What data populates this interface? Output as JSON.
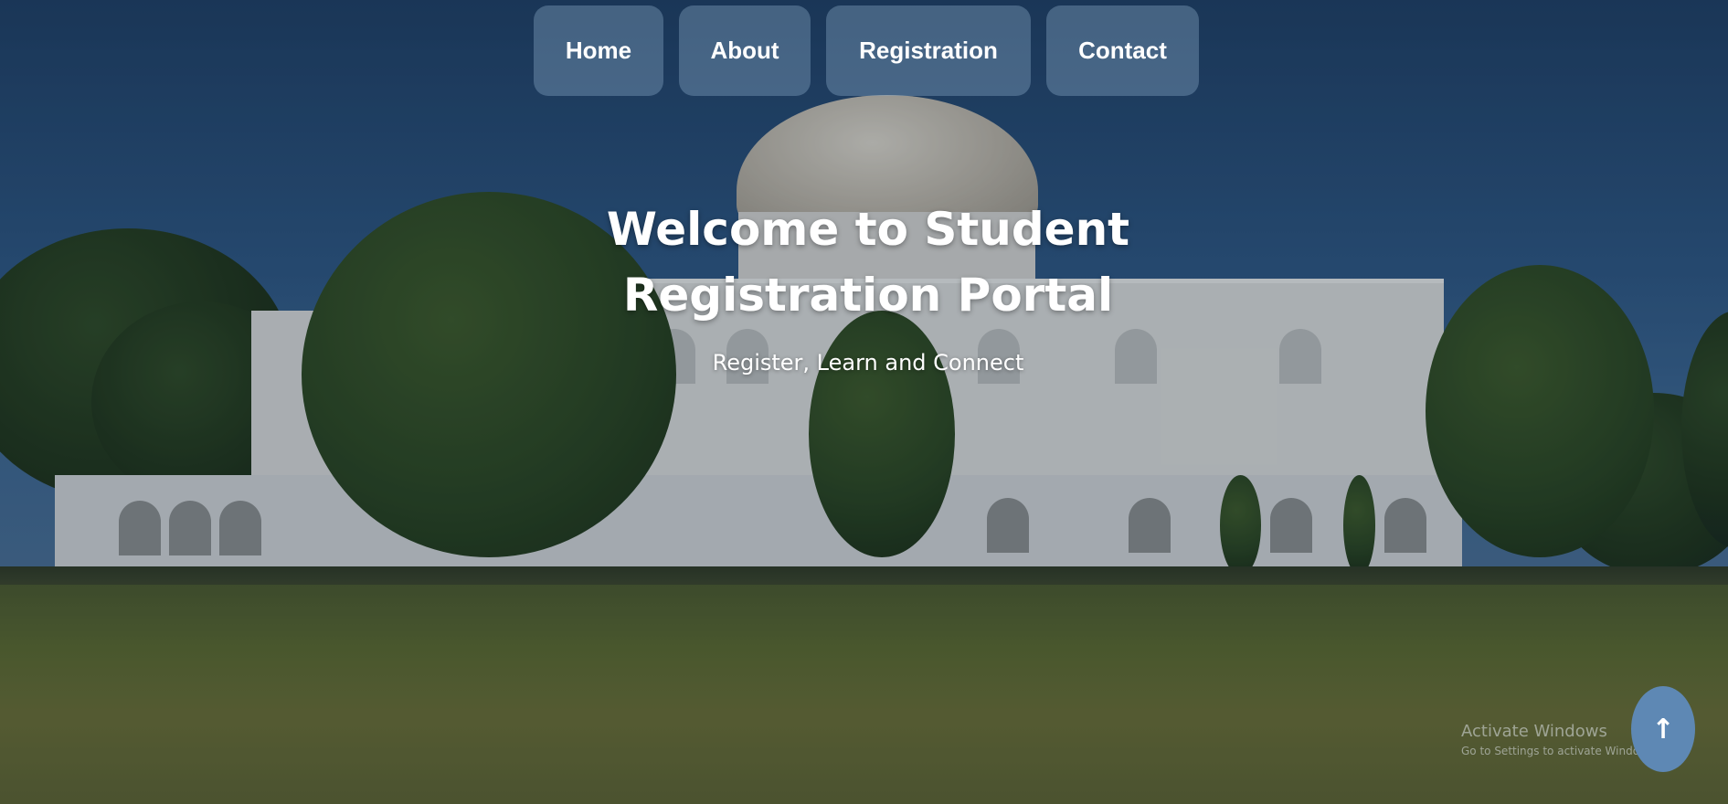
{
  "nav": {
    "items": [
      {
        "label": "Home"
      },
      {
        "label": "About"
      },
      {
        "label": "Registration"
      },
      {
        "label": "Contact"
      }
    ]
  },
  "hero": {
    "title": "Welcome to Student Registration Portal",
    "subtitle": "Register, Learn and Connect"
  },
  "watermark": {
    "title": "Activate Windows",
    "subtitle": "Go to Settings to activate Windows."
  },
  "back_to_top": {
    "icon": "arrow-up-icon",
    "glyph": "🠕"
  },
  "colors": {
    "nav_button_bg": "rgba(140, 170, 200, 0.38)",
    "back_to_top_bg": "#5e88b4",
    "text": "#ffffff"
  }
}
